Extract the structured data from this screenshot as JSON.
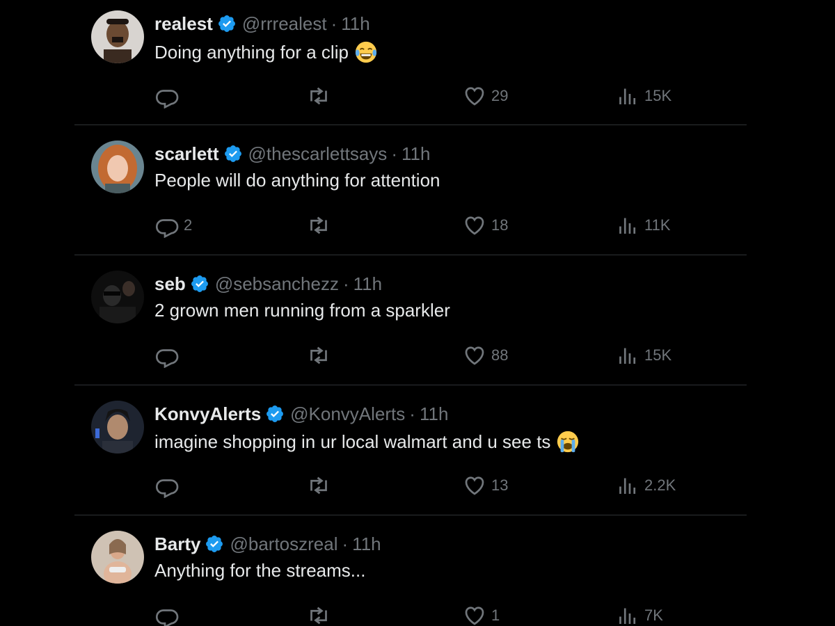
{
  "tweets": [
    {
      "name": "realest",
      "handle": "@rrrealest",
      "time": "11h",
      "text": "Doing anything for a clip",
      "emoji": "joy-emoji",
      "replies": "",
      "likes": "29",
      "views": "15K",
      "avatar_color": "#c9b49a"
    },
    {
      "name": "scarlett",
      "handle": "@thescarlettsays",
      "time": "11h",
      "text": "People will do anything for attention",
      "emoji": "",
      "replies": "2",
      "likes": "18",
      "views": "11K",
      "avatar_color": "#b86a3a"
    },
    {
      "name": "seb",
      "handle": "@sebsanchezz",
      "time": "11h",
      "text": "2 grown men running from a sparkler",
      "emoji": "",
      "replies": "",
      "likes": "88",
      "views": "15K",
      "avatar_color": "#1a1a1a"
    },
    {
      "name": "KonvyAlerts",
      "handle": "@KonvyAlerts",
      "time": "11h",
      "text": "imagine shopping in ur local walmart and u see ts",
      "emoji": "loudly-crying-emoji",
      "replies": "",
      "likes": "13",
      "views": "2.2K",
      "avatar_color": "#2a2b36"
    },
    {
      "name": "Barty",
      "handle": "@bartoszreal",
      "time": "11h",
      "text": "Anything for the streams...",
      "emoji": "",
      "replies": "",
      "likes": "1",
      "views": "7K",
      "avatar_color": "#b7a08c"
    }
  ],
  "colors": {
    "background": "#000000",
    "text": "#e7e9ea",
    "muted": "#71767b",
    "divider": "#2f3336",
    "verified": "#1d9bf0"
  },
  "separator": "·"
}
